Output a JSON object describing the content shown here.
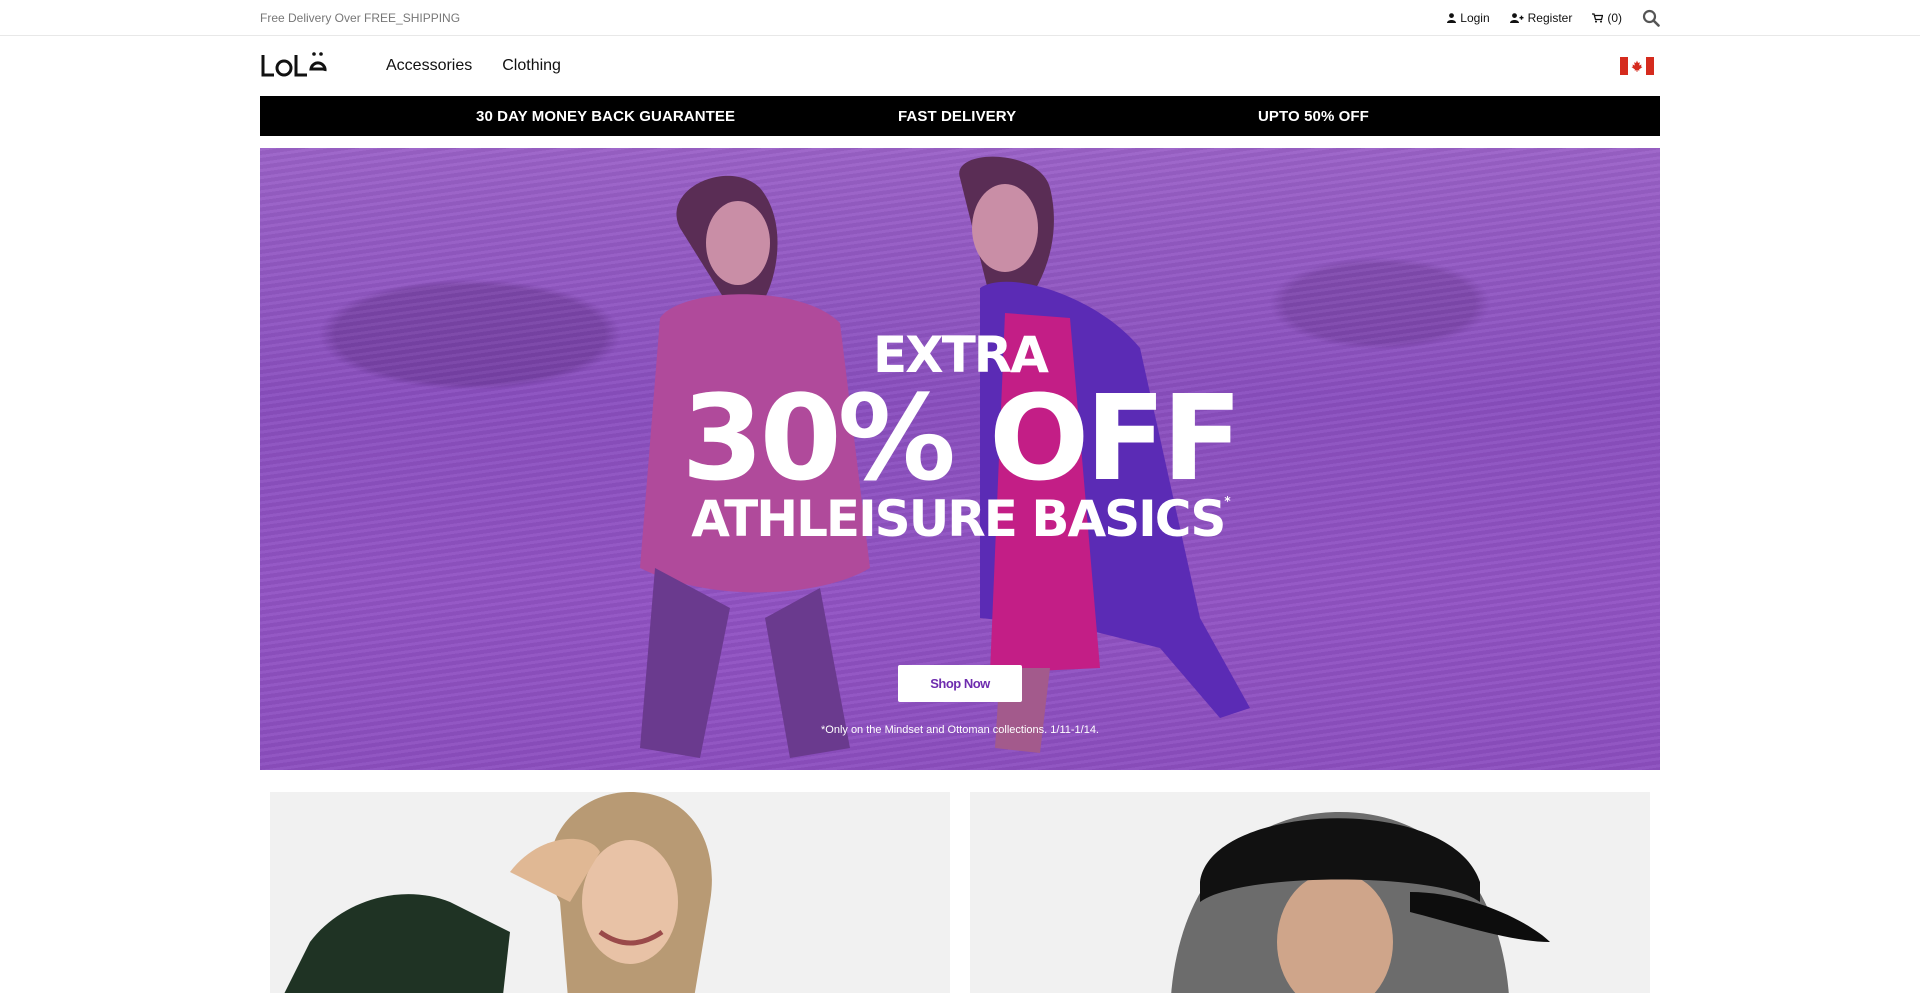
{
  "topbar": {
    "promo": "Free Delivery Over FREE_SHIPPING",
    "login_label": "Login",
    "register_label": "Register",
    "cart_label": "(0)",
    "icons": [
      "user-icon",
      "user-plus-icon",
      "cart-icon",
      "search-icon"
    ]
  },
  "header": {
    "logo_text": "LOLË",
    "nav": [
      "Accessories",
      "Clothing"
    ],
    "flag": "canada-flag-icon"
  },
  "benefits": [
    "30 DAY MONEY BACK GUARANTEE",
    "FAST DELIVERY",
    "UPTO 50% OFF"
  ],
  "hero": {
    "line1": "EXTRA",
    "line2": "30% OFF",
    "line3": "ATHLEISURE BASICS",
    "asterisk": "*",
    "button_label": "Shop Now",
    "disclaimer": "*Only on the Mindset and Ottoman collections. 1/11-1/14."
  },
  "colors": {
    "hero_bg": "#8d4fc0",
    "brand_purple": "#6e2cae",
    "benefits_bg": "#000000",
    "flag_red": "#d52b1e"
  }
}
